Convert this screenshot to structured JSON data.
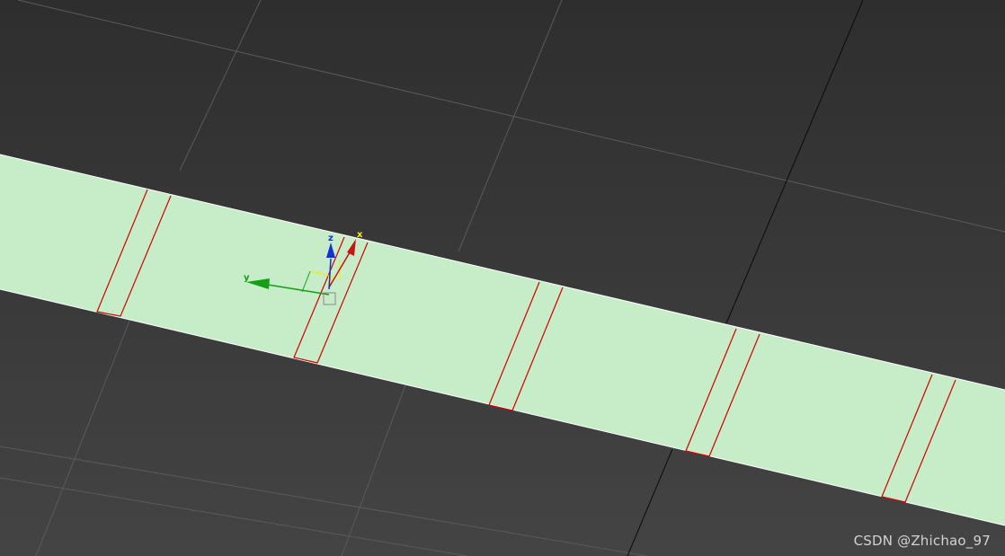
{
  "viewport": {
    "background_top": "#2e2e2e",
    "background_bottom": "#444444",
    "grid_color": "#5a5a5a",
    "home_grid_color": "#0b0b0b"
  },
  "strip": {
    "fill_color": "#c6ecc8",
    "seam_color": "#d40000",
    "edge_color": "#ffffff"
  },
  "gizmo": {
    "x_label": "x",
    "y_label": "y",
    "z_label": "z",
    "x_color": "#c81414",
    "y_color": "#14a014",
    "z_color": "#1432d2",
    "plane_color": "#f0f000"
  },
  "watermark": {
    "text": "CSDN @Zhichao_97"
  }
}
